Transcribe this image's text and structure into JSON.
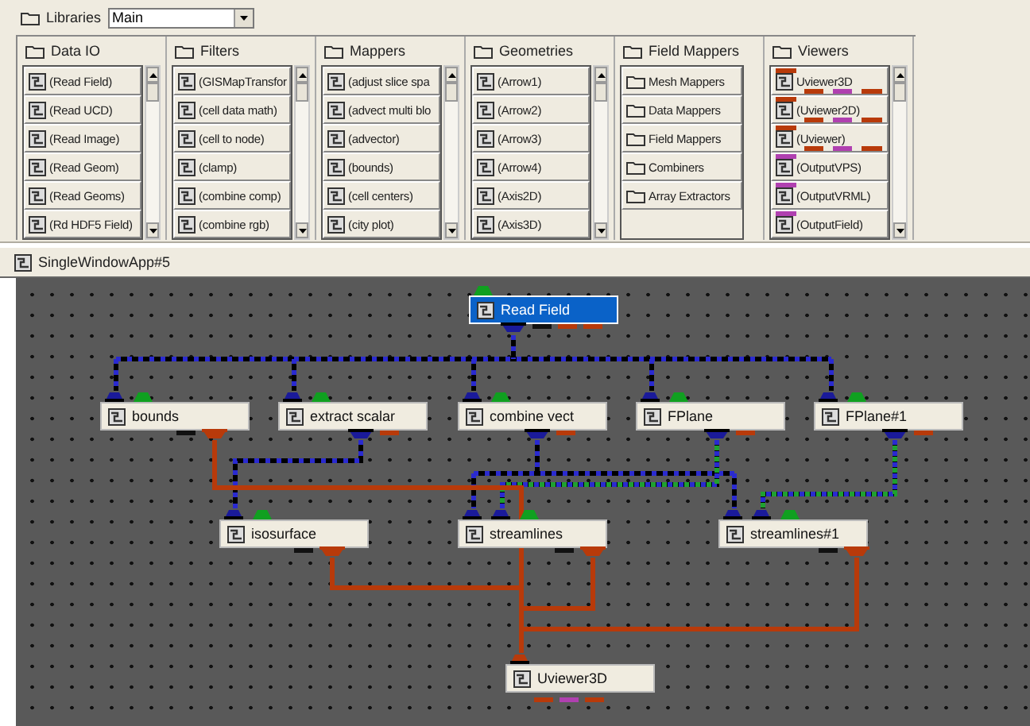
{
  "libraries": {
    "label": "Libraries",
    "value": "Main"
  },
  "columns": [
    {
      "title": "Data IO",
      "scrollbar": true,
      "items": [
        {
          "kind": "module",
          "label": "(Read Field)"
        },
        {
          "kind": "module",
          "label": "(Read UCD)"
        },
        {
          "kind": "module",
          "label": "(Read Image)"
        },
        {
          "kind": "module",
          "label": "(Read Geom)"
        },
        {
          "kind": "module",
          "label": "(Read Geoms)"
        },
        {
          "kind": "module",
          "label": "(Rd HDF5 Field)"
        }
      ]
    },
    {
      "title": "Filters",
      "scrollbar": true,
      "items": [
        {
          "kind": "module",
          "label": "(GISMapTransfor"
        },
        {
          "kind": "module",
          "label": "(cell data math)"
        },
        {
          "kind": "module",
          "label": "(cell to node)"
        },
        {
          "kind": "module",
          "label": "(clamp)"
        },
        {
          "kind": "module",
          "label": "(combine comp)"
        },
        {
          "kind": "module",
          "label": "(combine rgb)"
        }
      ]
    },
    {
      "title": "Mappers",
      "scrollbar": true,
      "items": [
        {
          "kind": "module",
          "label": "(adjust slice spa"
        },
        {
          "kind": "module",
          "label": "(advect multi blo"
        },
        {
          "kind": "module",
          "label": "(advector)"
        },
        {
          "kind": "module",
          "label": "(bounds)"
        },
        {
          "kind": "module",
          "label": "(cell centers)"
        },
        {
          "kind": "module",
          "label": "(city plot)"
        }
      ]
    },
    {
      "title": "Geometries",
      "scrollbar": true,
      "items": [
        {
          "kind": "module",
          "label": "(Arrow1)"
        },
        {
          "kind": "module",
          "label": "(Arrow2)"
        },
        {
          "kind": "module",
          "label": "(Arrow3)"
        },
        {
          "kind": "module",
          "label": "(Arrow4)"
        },
        {
          "kind": "module",
          "label": "(Axis2D)"
        },
        {
          "kind": "module",
          "label": "(Axis3D)"
        }
      ]
    },
    {
      "title": "Field Mappers",
      "scrollbar": false,
      "items": [
        {
          "kind": "folder",
          "label": "Mesh Mappers"
        },
        {
          "kind": "folder",
          "label": "Data Mappers"
        },
        {
          "kind": "folder",
          "label": "Field Mappers"
        },
        {
          "kind": "folder",
          "label": "Combiners"
        },
        {
          "kind": "folder",
          "label": "Array Extractors"
        }
      ]
    },
    {
      "title": "Viewers",
      "scrollbar": true,
      "items": [
        {
          "kind": "viewer",
          "label": "Uviewer3D"
        },
        {
          "kind": "viewer",
          "label": "(Uviewer2D)"
        },
        {
          "kind": "viewer",
          "label": "(Uviewer)"
        },
        {
          "kind": "output",
          "label": "(OutputVPS)"
        },
        {
          "kind": "output",
          "label": "(OutputVRML)"
        },
        {
          "kind": "output",
          "label": "(OutputField)"
        }
      ]
    }
  ],
  "network": {
    "title": "SingleWindowApp#5",
    "nodes": [
      {
        "label": "Read Field",
        "selected": true,
        "inputs": [
          {
            "kind": "control"
          }
        ],
        "outputs": [
          {
            "kind": "field",
            "connected": true
          },
          {
            "kind": "link",
            "connected": false
          },
          {
            "kind": "render",
            "connected": false
          },
          {
            "kind": "render",
            "connected": false
          }
        ]
      },
      {
        "label": "bounds",
        "selected": false,
        "inputs": [
          {
            "kind": "field"
          },
          {
            "kind": "control"
          }
        ],
        "outputs": [
          {
            "kind": "link",
            "connected": false
          },
          {
            "kind": "render",
            "connected": true
          }
        ]
      },
      {
        "label": "extract scalar",
        "selected": false,
        "inputs": [
          {
            "kind": "field"
          },
          {
            "kind": "control"
          }
        ],
        "outputs": [
          {
            "kind": "field",
            "connected": true
          },
          {
            "kind": "render",
            "connected": false
          }
        ]
      },
      {
        "label": "combine vect",
        "selected": false,
        "inputs": [
          {
            "kind": "field"
          },
          {
            "kind": "control"
          }
        ],
        "outputs": [
          {
            "kind": "field",
            "connected": true
          },
          {
            "kind": "render",
            "connected": false
          }
        ]
      },
      {
        "label": "FPlane",
        "selected": false,
        "inputs": [
          {
            "kind": "field"
          },
          {
            "kind": "control"
          }
        ],
        "outputs": [
          {
            "kind": "field",
            "connected": true
          },
          {
            "kind": "render",
            "connected": false
          }
        ]
      },
      {
        "label": "FPlane#1",
        "selected": false,
        "inputs": [
          {
            "kind": "field"
          },
          {
            "kind": "control"
          }
        ],
        "outputs": [
          {
            "kind": "field",
            "connected": true
          },
          {
            "kind": "render",
            "connected": false
          }
        ]
      },
      {
        "label": "isosurface",
        "selected": false,
        "inputs": [
          {
            "kind": "field"
          },
          {
            "kind": "control"
          }
        ],
        "outputs": [
          {
            "kind": "link",
            "connected": false
          },
          {
            "kind": "render",
            "connected": true
          }
        ]
      },
      {
        "label": "streamlines",
        "selected": false,
        "inputs": [
          {
            "kind": "field"
          },
          {
            "kind": "field"
          },
          {
            "kind": "control"
          }
        ],
        "outputs": [
          {
            "kind": "link",
            "connected": false
          },
          {
            "kind": "render",
            "connected": true
          }
        ]
      },
      {
        "label": "streamlines#1",
        "selected": false,
        "inputs": [
          {
            "kind": "field"
          },
          {
            "kind": "field"
          },
          {
            "kind": "control"
          }
        ],
        "outputs": [
          {
            "kind": "link",
            "connected": false
          },
          {
            "kind": "render",
            "connected": true
          }
        ]
      },
      {
        "label": "Uviewer3D",
        "selected": false,
        "inputs": [
          {
            "kind": "render"
          }
        ],
        "outputs": [
          {
            "kind": "render",
            "connected": false
          },
          {
            "kind": "view",
            "connected": false
          },
          {
            "kind": "render",
            "connected": false
          }
        ]
      }
    ]
  }
}
